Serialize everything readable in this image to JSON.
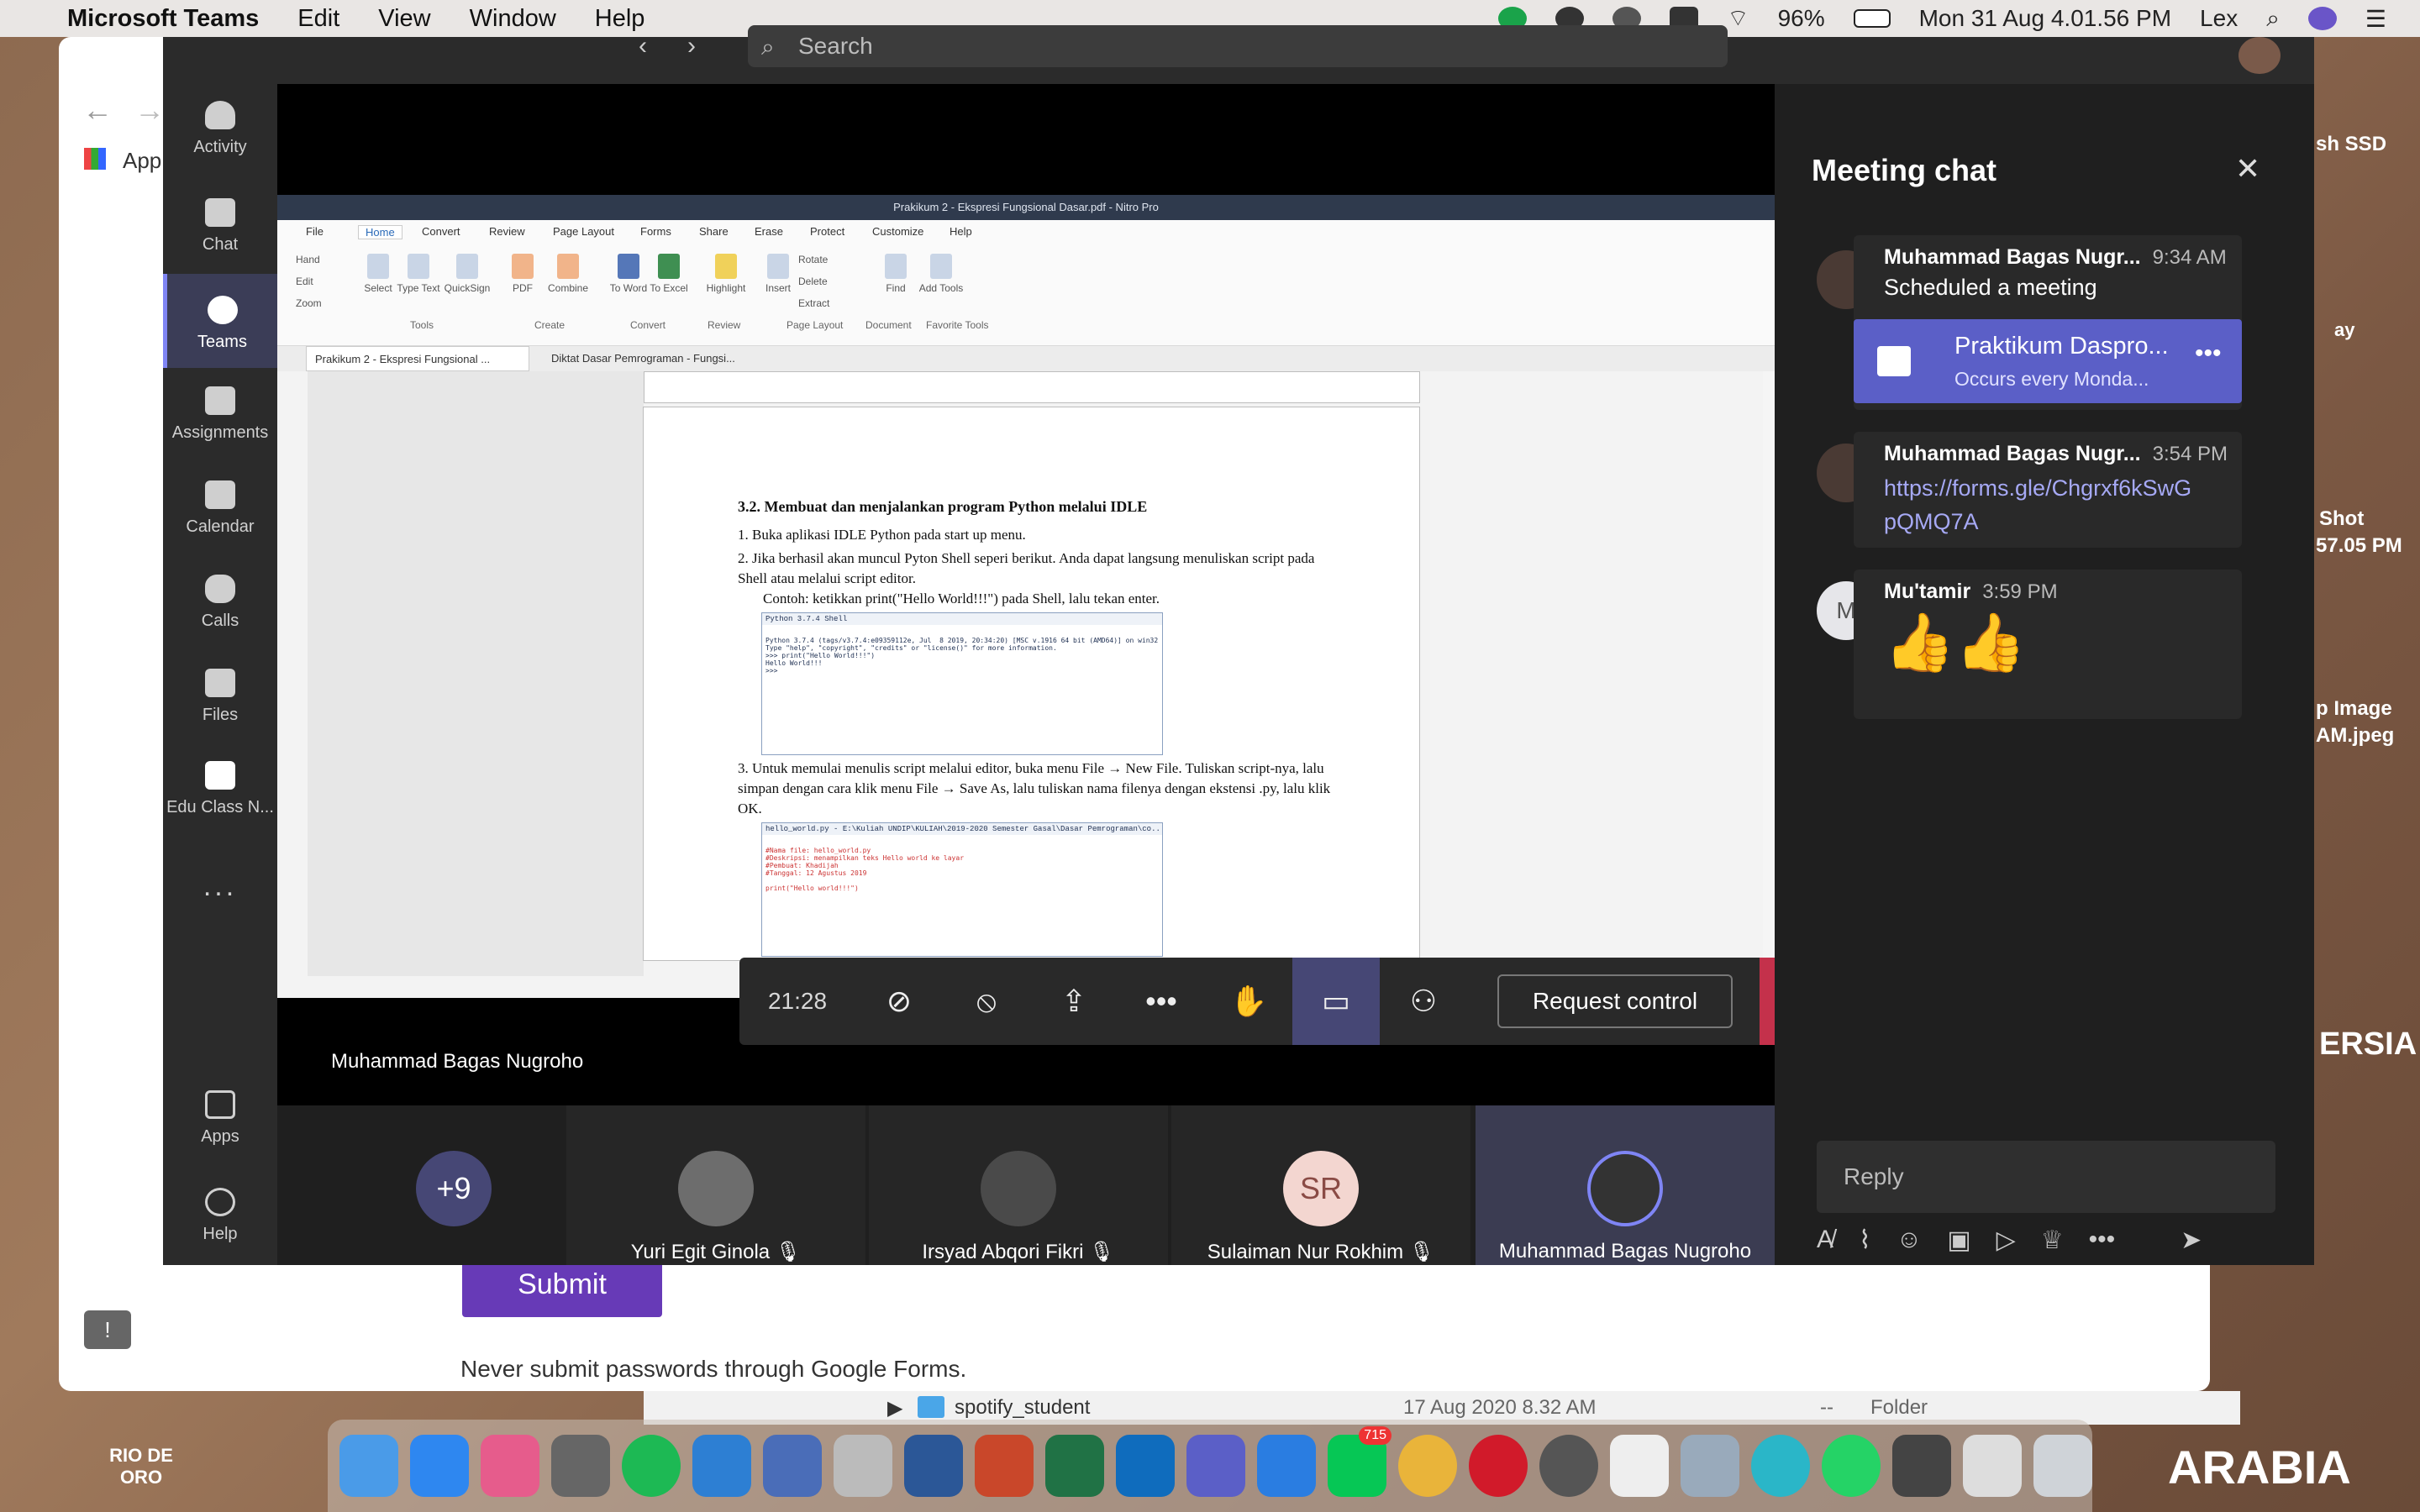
{
  "menubar": {
    "app": "Microsoft Teams",
    "items": [
      "Edit",
      "View",
      "Window",
      "Help"
    ],
    "battery": "96%",
    "clock": "Mon 31 Aug  4.01.56 PM",
    "user": "Lex"
  },
  "teams": {
    "search_placeholder": "Search",
    "rail": [
      "Activity",
      "Chat",
      "Teams",
      "Assignments",
      "Calendar",
      "Calls",
      "Files",
      "Edu Class N...",
      "...",
      "Apps",
      "Help"
    ]
  },
  "pdf": {
    "title": "Prakikum 2 - Ekspresi Fungsional Dasar.pdf - Nitro Pro",
    "menu": [
      "File",
      "Home",
      "Convert",
      "Review",
      "Page Layout",
      "Forms",
      "Share",
      "Erase",
      "Protect",
      "Customize",
      "Help"
    ],
    "tools": [
      "Hand",
      "Edit",
      "Zoom",
      "Select",
      "Type Text",
      "QuickSign",
      "PDF",
      "Combine",
      "To Word",
      "To Excel",
      "Highlight",
      "Insert",
      "Rotate",
      "Delete",
      "Extract",
      "Find",
      "Add Tools"
    ],
    "groups": [
      "Tools",
      "Create",
      "Convert",
      "Review",
      "Page Layout",
      "Document",
      "Favorite Tools"
    ],
    "tabs": [
      "Prakikum 2 - Ekspresi Fungsional ...",
      "Diktat Dasar Pemrograman - Fungsi..."
    ],
    "heading": "3.2.  Membuat dan menjalankan program Python melalui IDLE",
    "p1": "1.   Buka aplikasi IDLE Python pada start up menu.",
    "p2": "2.   Jika berhasil akan muncul Pyton Shell seperi berikut. Anda dapat langsung menuliskan script pada Shell atau melalui script editor.",
    "p2b": "Contoh: ketikkan print(\"Hello World!!!\") pada Shell, lalu tekan enter.",
    "shell_title": "Python 3.7.4 Shell",
    "shell_text": "Python 3.7.4 (tags/v3.7.4:e09359112e, Jul  8 2019, 20:34:20) [MSC v.1916 64 bit (AMD64)] on win32\nType \"help\", \"copyright\", \"credits\" or \"license()\" for more information.\n>>> print(\"Hello World!!!\")\nHello World!!!\n>>>",
    "p3": "3.   Untuk memulai menulis script melalui editor, buka menu File → New File. Tuliskan script-nya, lalu simpan dengan cara klik menu File → Save As, lalu tuliskan nama filenya dengan ekstensi .py, lalu klik OK.",
    "editor_title": "hello_world.py - E:\\Kuliah UNDIP\\KULIAH\\2019-2020 Semester Gasal\\Dasar Pemrograman\\co...",
    "editor_text": "#Nama file: hello_world.py\n#Deskripsi: menampilkan teks Hello world ke layar\n#Pembuat: Khadijah\n#Tanggal: 12 Agustus 2019\n\nprint(\"Hello world!!!\")"
  },
  "presenter": "Muhammad Bagas Nugroho",
  "controls": {
    "timer": "21:28",
    "request": "Request control"
  },
  "participants": [
    {
      "name": "+9",
      "label": ""
    },
    {
      "name": "",
      "label": "Yuri Egit Ginola"
    },
    {
      "name": "",
      "label": "Irsyad Abqori Fikri"
    },
    {
      "name": "SR",
      "label": "Sulaiman Nur Rokhim"
    },
    {
      "name": "",
      "label": "Muhammad Bagas Nugroho"
    }
  ],
  "chat": {
    "title": "Meeting chat",
    "messages": [
      {
        "sender": "Muhammad Bagas Nugr...",
        "time": "9:34 AM",
        "body": "Scheduled a meeting"
      },
      {
        "sender": "Muhammad Bagas Nugr...",
        "time": "3:54 PM",
        "body": "https://forms.gle/Chgrxf6kSwG pQMQ7A"
      },
      {
        "sender": "Mu'tamir",
        "time": "3:59 PM",
        "body": "👍👍",
        "initial": "M"
      }
    ],
    "meeting": {
      "title": "Praktikum Daspro...",
      "subtitle": "Occurs every Monda..."
    },
    "reply": "Reply"
  },
  "background": {
    "submit": "Submit",
    "never": "Never submit passwords through Google Forms.",
    "finder_name": "spotify_student",
    "finder_date": "17 Aug 2020 8.32 AM",
    "finder_size": "--",
    "finder_kind": "Folder",
    "apps_label": "App"
  },
  "desktop": {
    "ssd": "sh SSD",
    "day": "ay",
    "shot": "Shot",
    "shot_time": "57.05 PM",
    "image": "p Image",
    "image2": "AM.jpeg",
    "ersia": "ERSIA",
    "rio": "RIO DE ORO",
    "arabia": "ARABIA"
  },
  "dock": {
    "badge": "715"
  },
  "colors": {
    "accent": "#5b5fc7",
    "hangup": "#c4314b",
    "submit": "#673ab7"
  }
}
